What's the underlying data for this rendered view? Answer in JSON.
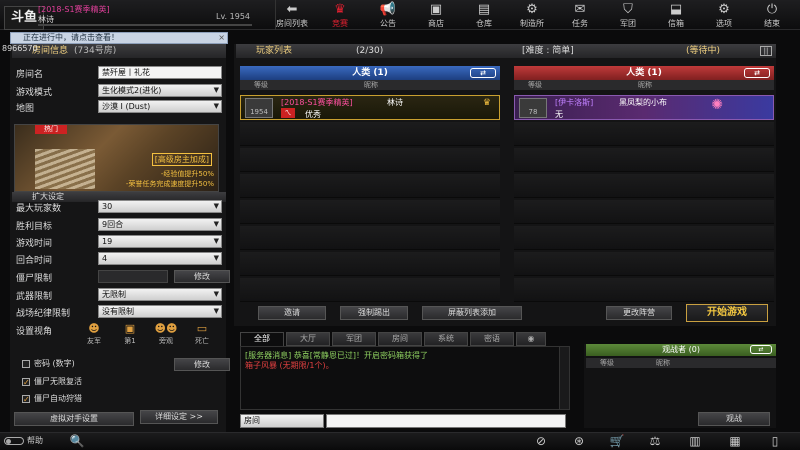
{
  "app": {
    "logo": "斗鱼"
  },
  "player": {
    "season_tag": "[2018-S1赛季精英]",
    "name": "林诗",
    "level": "Lv. 1954"
  },
  "nav": [
    {
      "label": "房间列表",
      "icon": "back-arrow-icon"
    },
    {
      "label": "竞赛",
      "icon": "crown-icon"
    },
    {
      "label": "公告",
      "icon": "megaphone-icon"
    },
    {
      "label": "商店",
      "icon": "shop-icon"
    },
    {
      "label": "仓库",
      "icon": "warehouse-icon"
    },
    {
      "label": "制造所",
      "icon": "factory-icon"
    },
    {
      "label": "任务",
      "icon": "mission-icon"
    },
    {
      "label": "军团",
      "icon": "clan-icon"
    },
    {
      "label": "信箱",
      "icon": "mail-icon"
    },
    {
      "label": "选项",
      "icon": "gear-icon"
    },
    {
      "label": "结束",
      "icon": "power-icon"
    }
  ],
  "notice": {
    "text": "正在进行中，请点击查看！",
    "close": "×",
    "room_id": "8966570"
  },
  "room_info": {
    "title": "房间信息",
    "room_no": "(734号房)",
    "room_name_label": "房间名",
    "room_name": "禁歼屋丨礼花",
    "mode_label": "游戏模式",
    "mode": "生化模式2(进化)",
    "map_label": "地图",
    "map": "沙漠 I (Dust)",
    "hot_tag": "热门",
    "map_bonus_title": "[高级房主加成]",
    "map_bonus_1": "-经验值提升50%",
    "map_bonus_2": "-荣誉任务完成速度提升50%",
    "advanced_label": "扩大设定",
    "max_players_label": "最大玩家数",
    "max_players": "30",
    "win_label": "胜利目标",
    "win": "9回合",
    "game_time_label": "游戏时间",
    "game_time": "19",
    "round_time_label": "回合时间",
    "round_time": "4",
    "zombie_limit_label": "僵尸限制",
    "modify": "修改",
    "weapon_limit_label": "武器限制",
    "weapon_limit": "无限制",
    "discipline_label": "战场纪律限制",
    "discipline": "没有限制",
    "view_label": "设置视角",
    "views": [
      {
        "label": "友军",
        "icon": "friendly-view-icon"
      },
      {
        "label": "第1",
        "icon": "first-person-icon"
      },
      {
        "label": "旁观",
        "icon": "spectator-view-icon"
      },
      {
        "label": "死亡",
        "icon": "death-cam-icon"
      }
    ],
    "password_label": "密码 (数字)",
    "modify2": "修改",
    "unlimited_revive": "僵尸无限复活",
    "auto_trap": "僵尸自动狩猎",
    "virtual_btn": "虚拟对手设置",
    "detail_btn": "详细设定 >>"
  },
  "player_list": {
    "title": "玩家列表",
    "count": "(2/30)",
    "difficulty": "[难度 : 简单]",
    "status": "(等待中)",
    "pause": "||",
    "team_blue": "人类 (1)",
    "team_red": "人类 (1)",
    "col_level": "等级",
    "col_nick": "昵称",
    "blue_player": {
      "season": "[2018-S1赛季精英]",
      "name": "林诗",
      "level": "1954",
      "rank": "优秀",
      "badge": "ㄟ"
    },
    "red_player": {
      "season": "[伊卡洛斯]",
      "name": "黑凤梨的小布",
      "level": "78",
      "rank": "无"
    },
    "invite": "邀请",
    "kick": "强制踢出",
    "block": "屏蔽列表添加",
    "change_team": "更改阵营",
    "start": "开始游戏"
  },
  "chat": {
    "tabs": [
      "全部",
      "大厅",
      "军团",
      "房间",
      "系统",
      "密语"
    ],
    "line1": "[服务器消息] 恭喜[常静恩已过]！开启密码箱获得了",
    "line2": "箱子风暴 (无期限/1个)。",
    "channel": "房间"
  },
  "observers": {
    "title": "观战者 (0)",
    "col_level": "等级",
    "col_nick": "昵称",
    "watch_btn": "观战"
  },
  "bottom": {
    "help": "帮助"
  }
}
